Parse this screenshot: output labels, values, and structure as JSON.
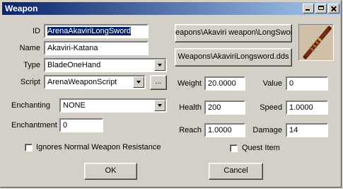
{
  "window": {
    "title": "Weapon"
  },
  "fields": {
    "id_label": "ID",
    "id_value": "ArenaAkaviriLongSword",
    "name_label": "Name",
    "name_value": "Akaviri-Katana",
    "type_label": "Type",
    "type_value": "BladeOneHand",
    "script_label": "Script",
    "script_value": "ArenaWeaponScript",
    "script_browse": "...",
    "enchanting_label": "Enchanting",
    "enchanting_value": "NONE",
    "enchantment_label": "Enchantment",
    "enchantment_value": "0"
  },
  "paths": {
    "model_button": "eapons\\Akaviri weapon\\LongSword",
    "icon_button": "Weapons\\AkaviriLongsword.dds"
  },
  "stats": {
    "weight_label": "Weight",
    "weight_value": "20.0000",
    "value_label": "Value",
    "value_value": "0",
    "health_label": "Health",
    "health_value": "200",
    "speed_label": "Speed",
    "speed_value": "1.0000",
    "reach_label": "Reach",
    "reach_value": "1.0000",
    "damage_label": "Damage",
    "damage_value": "14"
  },
  "checkboxes": {
    "ignores_resistance": "Ignores Normal Weapon Resistance",
    "quest_item": "Quest Item"
  },
  "buttons": {
    "ok": "OK",
    "cancel": "Cancel"
  },
  "icon": {
    "name": "katana-icon"
  }
}
